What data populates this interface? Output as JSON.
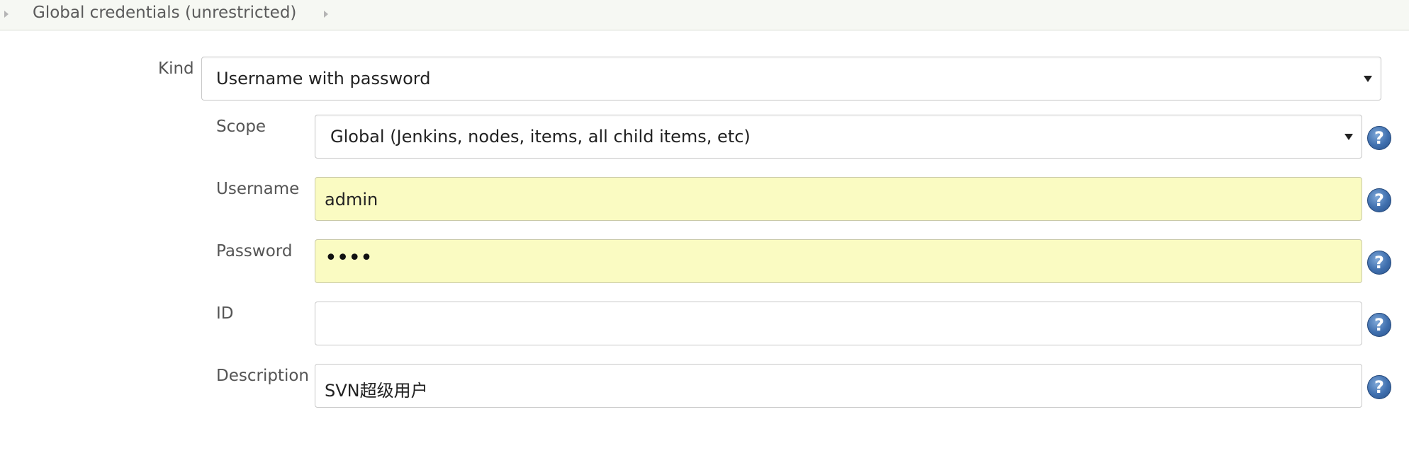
{
  "breadcrumb": {
    "label": "Global credentials (unrestricted)"
  },
  "form": {
    "kind": {
      "label": "Kind",
      "value": "Username with password"
    },
    "scope": {
      "label": "Scope",
      "value": "Global (Jenkins, nodes, items, all child items, etc)"
    },
    "username": {
      "label": "Username",
      "value": "admin"
    },
    "password": {
      "label": "Password",
      "value": "••••"
    },
    "id": {
      "label": "ID",
      "value": ""
    },
    "description": {
      "label": "Description",
      "value": "SVN超级用户"
    }
  },
  "help_icon_glyph": "?",
  "colors": {
    "autofill_background": "#fafbc2",
    "help_icon": "#3f6fae"
  }
}
